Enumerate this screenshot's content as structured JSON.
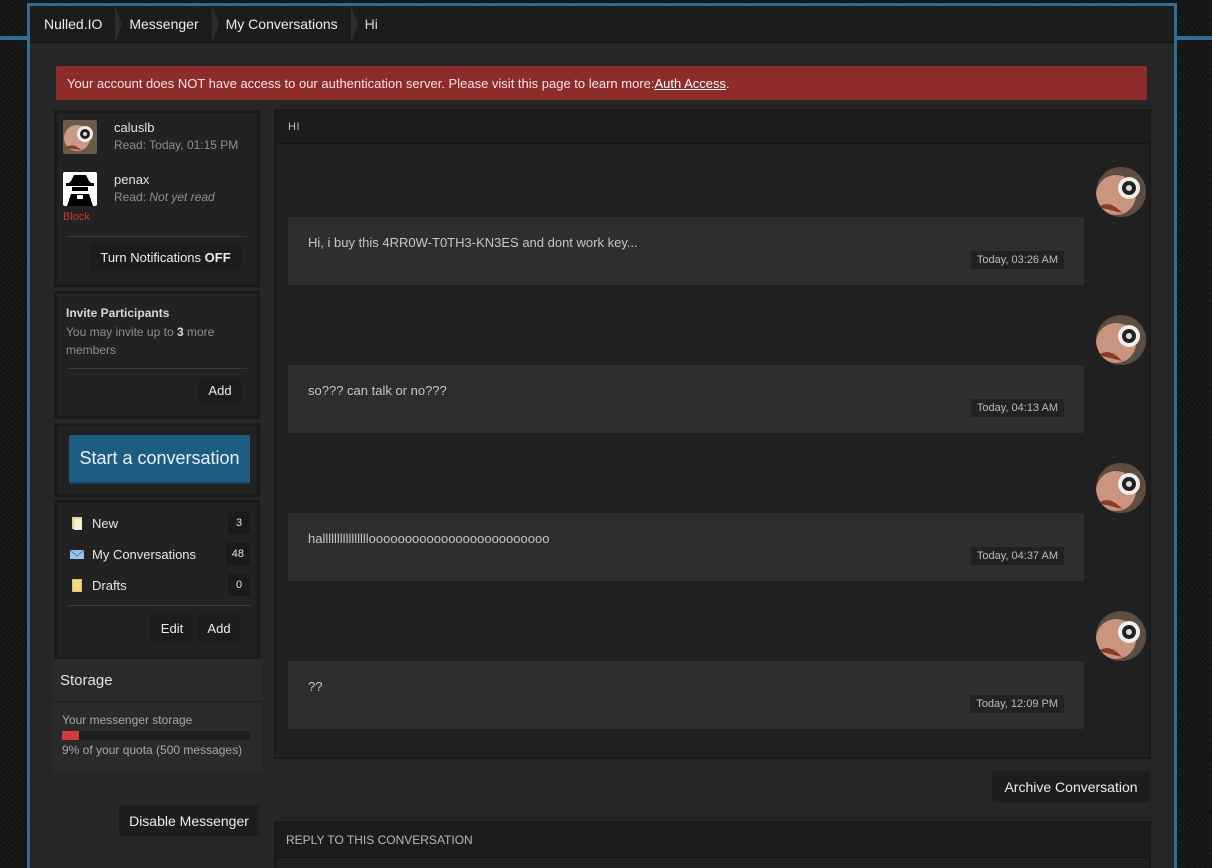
{
  "breadcrumb": [
    "Nulled.IO",
    "Messenger",
    "My Conversations",
    "Hi"
  ],
  "alert": {
    "text": "Your account does NOT have access to our authentication server. Please visit this page to learn more: ",
    "link": "Auth Access",
    "end": "."
  },
  "participants": [
    {
      "name": "caluslb",
      "read_prefix": "Read: ",
      "read_value": "Today, 01:15 PM"
    },
    {
      "name": "penax",
      "read_prefix": "Read: ",
      "read_value": "Not yet read",
      "block_label": "Block"
    }
  ],
  "notifications": {
    "label": "Turn Notifications ",
    "state": "OFF"
  },
  "invite": {
    "title": "Invite Participants",
    "sub_pre": "You may invite up to ",
    "count": "3",
    "sub_post": " more members",
    "add_label": "Add"
  },
  "start_conversation": "Start a conversation",
  "folders": [
    {
      "label": "New",
      "count": "3",
      "icon": "new-folder-icon"
    },
    {
      "label": "My Conversations",
      "count": "48",
      "icon": "envelope-icon"
    },
    {
      "label": "Drafts",
      "count": "0",
      "icon": "drafts-folder-icon"
    }
  ],
  "folder_actions": {
    "edit": "Edit",
    "add": "Add"
  },
  "storage": {
    "title": "Storage",
    "sub": "Your messenger storage",
    "percent": 9,
    "quota": "9% of your quota (500 messages)"
  },
  "disable_messenger": "Disable Messenger",
  "conversation": {
    "title": "HI",
    "messages": [
      {
        "text": "Hi, i buy this 4RR0W-T0TH3-KN3ES and dont work key...",
        "time": "Today, 03:26 AM"
      },
      {
        "text": "so??? can talk or no???",
        "time": "Today, 04:13 AM"
      },
      {
        "text": "hallllllllllllllllooooooooooooooooooooooooo",
        "time": "Today, 04:37 AM"
      },
      {
        "text": "??",
        "time": "Today, 12:09 PM"
      }
    ]
  },
  "archive_label": "Archive Conversation",
  "reply_title": "REPLY TO THIS CONVERSATION",
  "colors": {
    "accent": "#2f6f97",
    "alert_bg": "#8e2b2b",
    "start_btn": "#1e5d82",
    "quota_bar": "#d13b3b"
  }
}
